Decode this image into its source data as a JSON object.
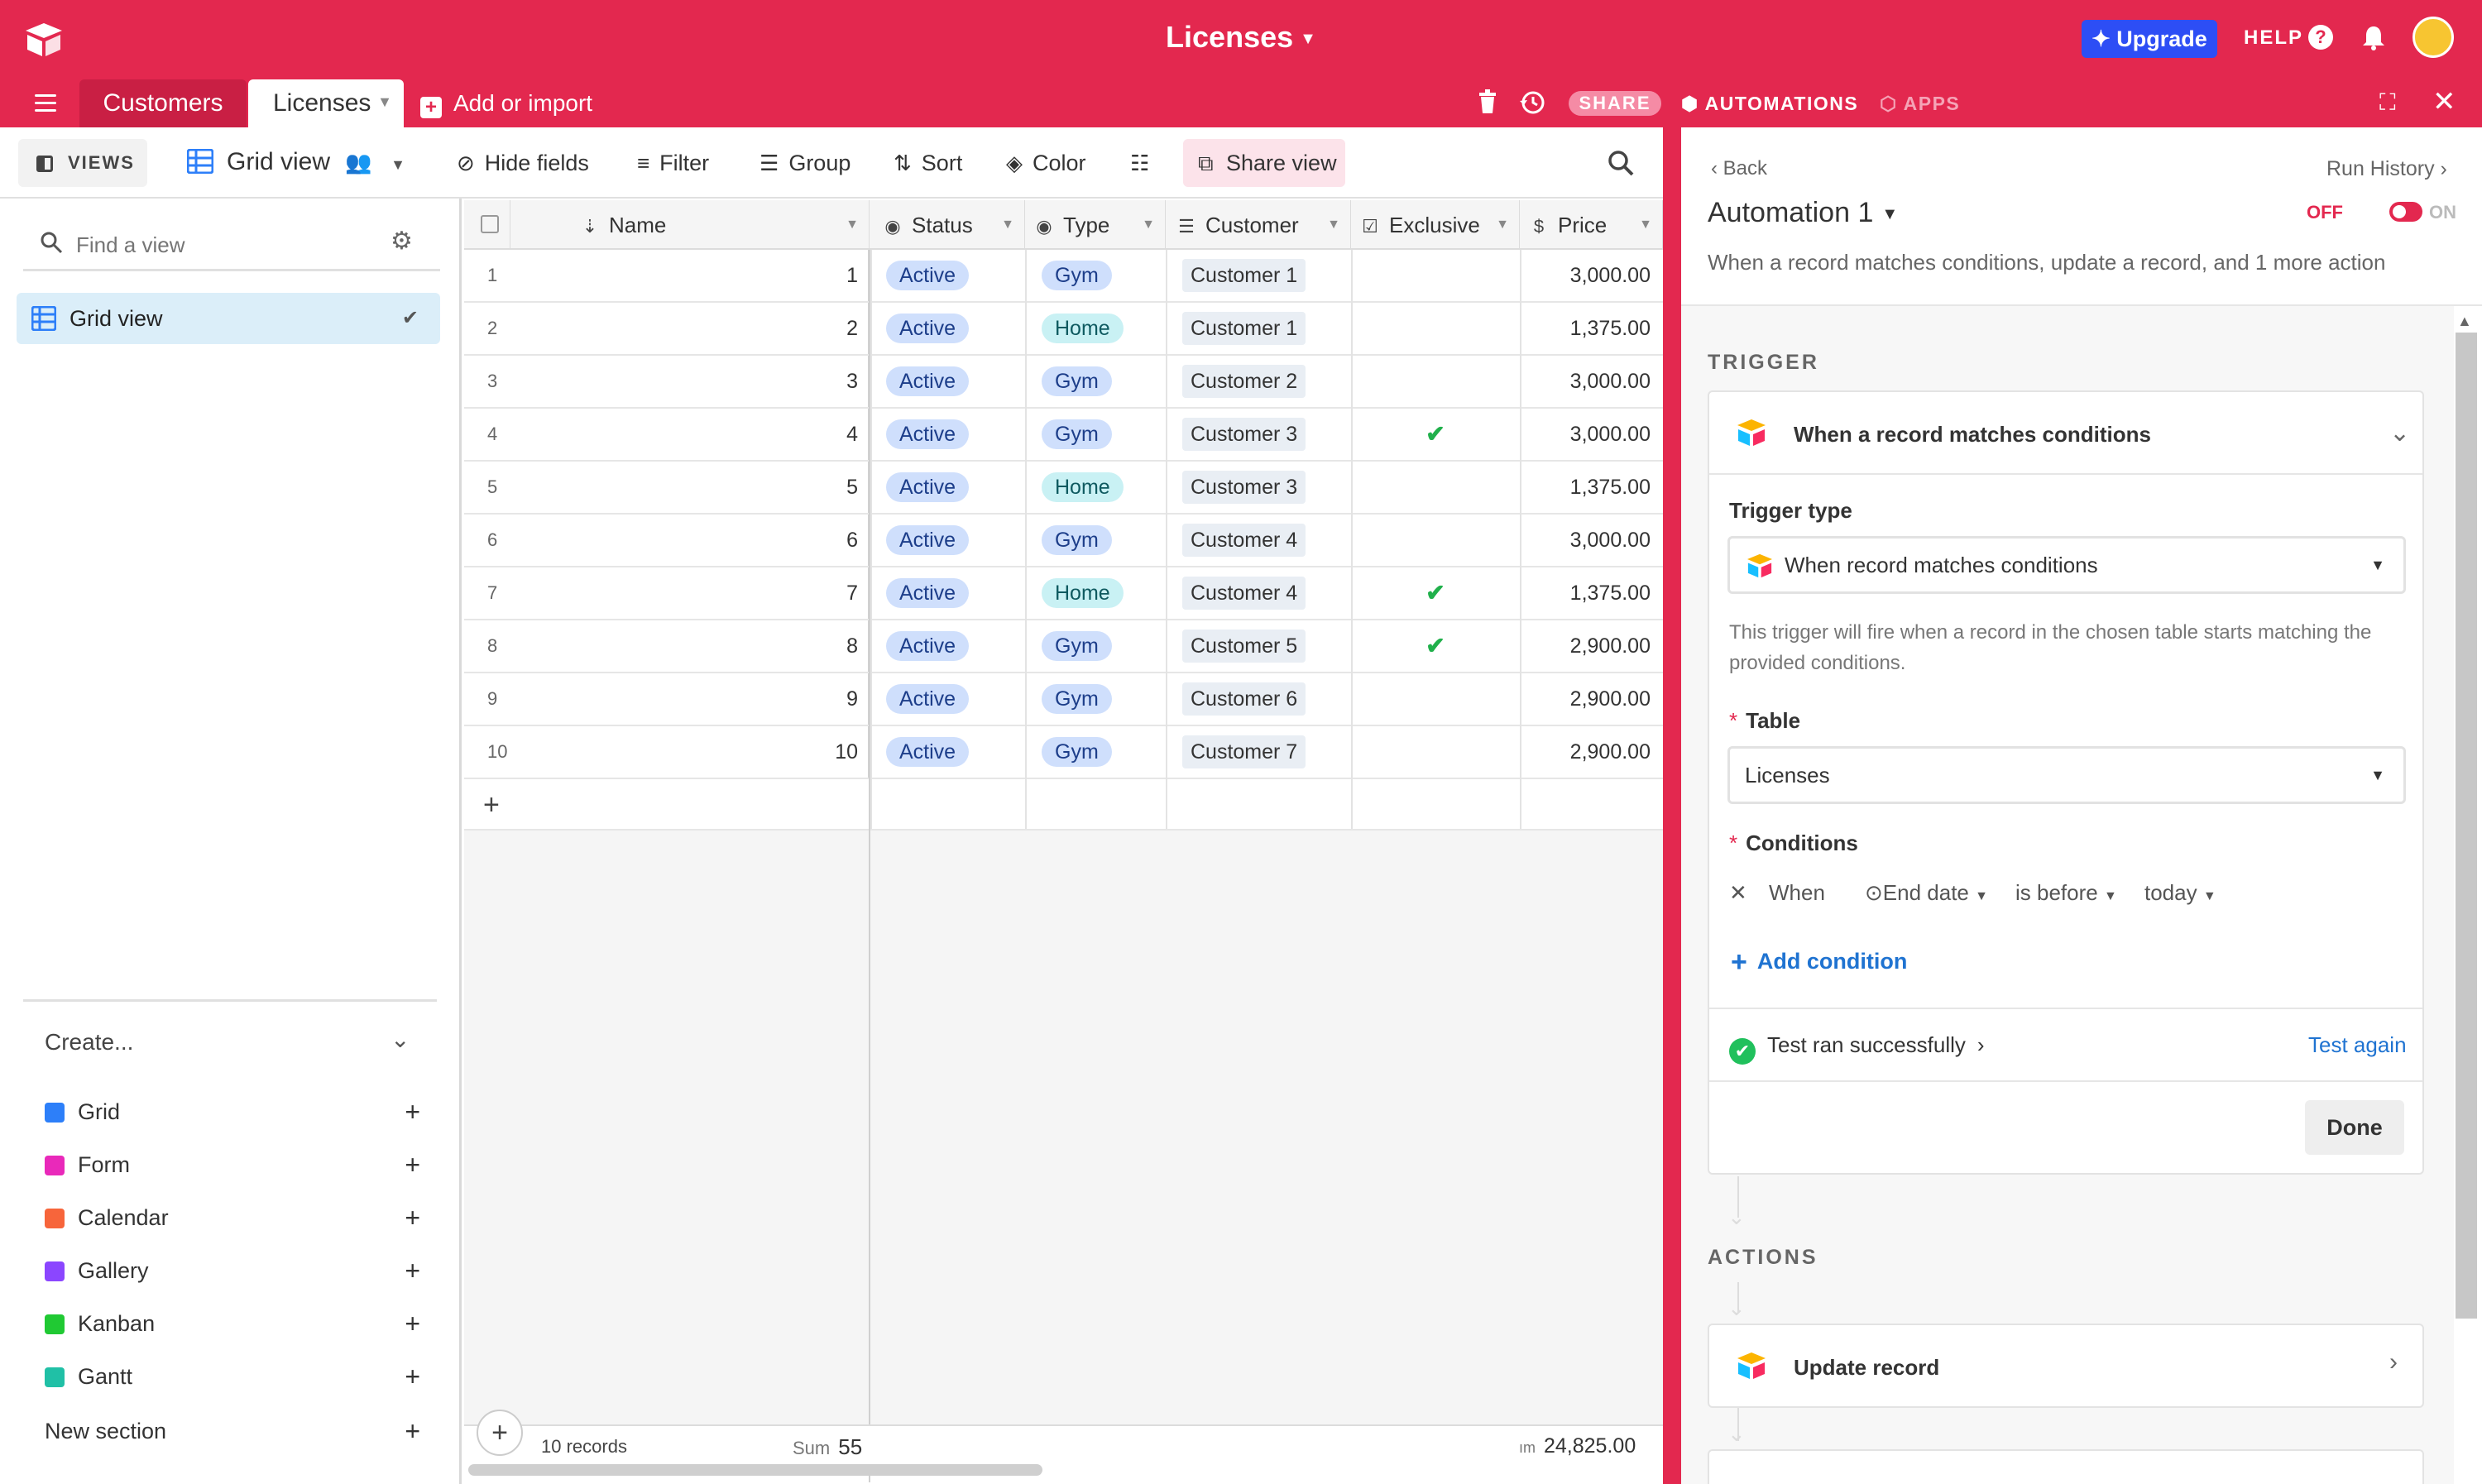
{
  "header": {
    "base_title": "Licenses",
    "upgrade_label": "Upgrade",
    "help_label": "HELP"
  },
  "tabs": {
    "customers": "Customers",
    "licenses": "Licenses",
    "add_import": "Add or import",
    "share": "SHARE",
    "automations": "AUTOMATIONS",
    "apps": "APPS"
  },
  "toolbar": {
    "views": "VIEWS",
    "grid_view": "Grid view",
    "hide_fields": "Hide fields",
    "filter": "Filter",
    "group": "Group",
    "sort": "Sort",
    "color": "Color",
    "share_view": "Share view"
  },
  "sidebar": {
    "find_placeholder": "Find a view",
    "active_view": "Grid view",
    "create_label": "Create...",
    "create_items": [
      {
        "label": "Grid",
        "color": "#2d7ff9"
      },
      {
        "label": "Form",
        "color": "#e929ba"
      },
      {
        "label": "Calendar",
        "color": "#f7653b"
      },
      {
        "label": "Gallery",
        "color": "#8b46ff"
      },
      {
        "label": "Kanban",
        "color": "#20c933"
      },
      {
        "label": "Gantt",
        "color": "#20c0a6"
      }
    ],
    "new_section": "New section"
  },
  "grid": {
    "columns": {
      "name": "Name",
      "status": "Status",
      "type": "Type",
      "customer": "Customer",
      "exclusive": "Exclusive",
      "price": "Price"
    },
    "rows": [
      {
        "num": "1",
        "name": "1",
        "status": "Active",
        "type": "Gym",
        "customer": "Customer 1",
        "exclusive": "",
        "price": "3,000.00"
      },
      {
        "num": "2",
        "name": "2",
        "status": "Active",
        "type": "Home",
        "customer": "Customer 1",
        "exclusive": "",
        "price": "1,375.00"
      },
      {
        "num": "3",
        "name": "3",
        "status": "Active",
        "type": "Gym",
        "customer": "Customer 2",
        "exclusive": "",
        "price": "3,000.00"
      },
      {
        "num": "4",
        "name": "4",
        "status": "Active",
        "type": "Gym",
        "customer": "Customer 3",
        "exclusive": "✔",
        "price": "3,000.00"
      },
      {
        "num": "5",
        "name": "5",
        "status": "Active",
        "type": "Home",
        "customer": "Customer 3",
        "exclusive": "",
        "price": "1,375.00"
      },
      {
        "num": "6",
        "name": "6",
        "status": "Active",
        "type": "Gym",
        "customer": "Customer 4",
        "exclusive": "",
        "price": "3,000.00"
      },
      {
        "num": "7",
        "name": "7",
        "status": "Active",
        "type": "Home",
        "customer": "Customer 4",
        "exclusive": "✔",
        "price": "1,375.00"
      },
      {
        "num": "8",
        "name": "8",
        "status": "Active",
        "type": "Gym",
        "customer": "Customer 5",
        "exclusive": "✔",
        "price": "2,900.00"
      },
      {
        "num": "9",
        "name": "9",
        "status": "Active",
        "type": "Gym",
        "customer": "Customer 6",
        "exclusive": "",
        "price": "2,900.00"
      },
      {
        "num": "10",
        "name": "10",
        "status": "Active",
        "type": "Gym",
        "customer": "Customer 7",
        "exclusive": "",
        "price": "2,900.00"
      }
    ],
    "footer": {
      "records": "10 records",
      "sum_label": "Sum",
      "sum_value": "55",
      "price_sum_label": "ım",
      "price_sum": "24,825.00"
    }
  },
  "automation": {
    "back": "Back",
    "run_history": "Run History",
    "title": "Automation 1",
    "off": "OFF",
    "on": "ON",
    "description": "When a record matches conditions, update a record, and 1 more action",
    "trigger_section": "TRIGGER",
    "trigger_title": "When a record matches conditions",
    "trigger_type_label": "Trigger type",
    "trigger_type_value": "When record matches conditions",
    "trigger_help": "This trigger will fire when a record in the chosen table starts matching the provided conditions.",
    "table_label": "Table",
    "table_value": "Licenses",
    "conditions_label": "Conditions",
    "cond_when": "When",
    "cond_field": "End date",
    "cond_op": "is before",
    "cond_value": "today",
    "add_condition": "Add condition",
    "test_status": "Test ran successfully",
    "test_again": "Test again",
    "done": "Done",
    "actions_section": "ACTIONS",
    "action_1": "Update record"
  },
  "colors": {
    "brand": "#e3284f",
    "upgrade": "#2d4ef5",
    "link": "#1f73d1",
    "success": "#20c05c"
  }
}
